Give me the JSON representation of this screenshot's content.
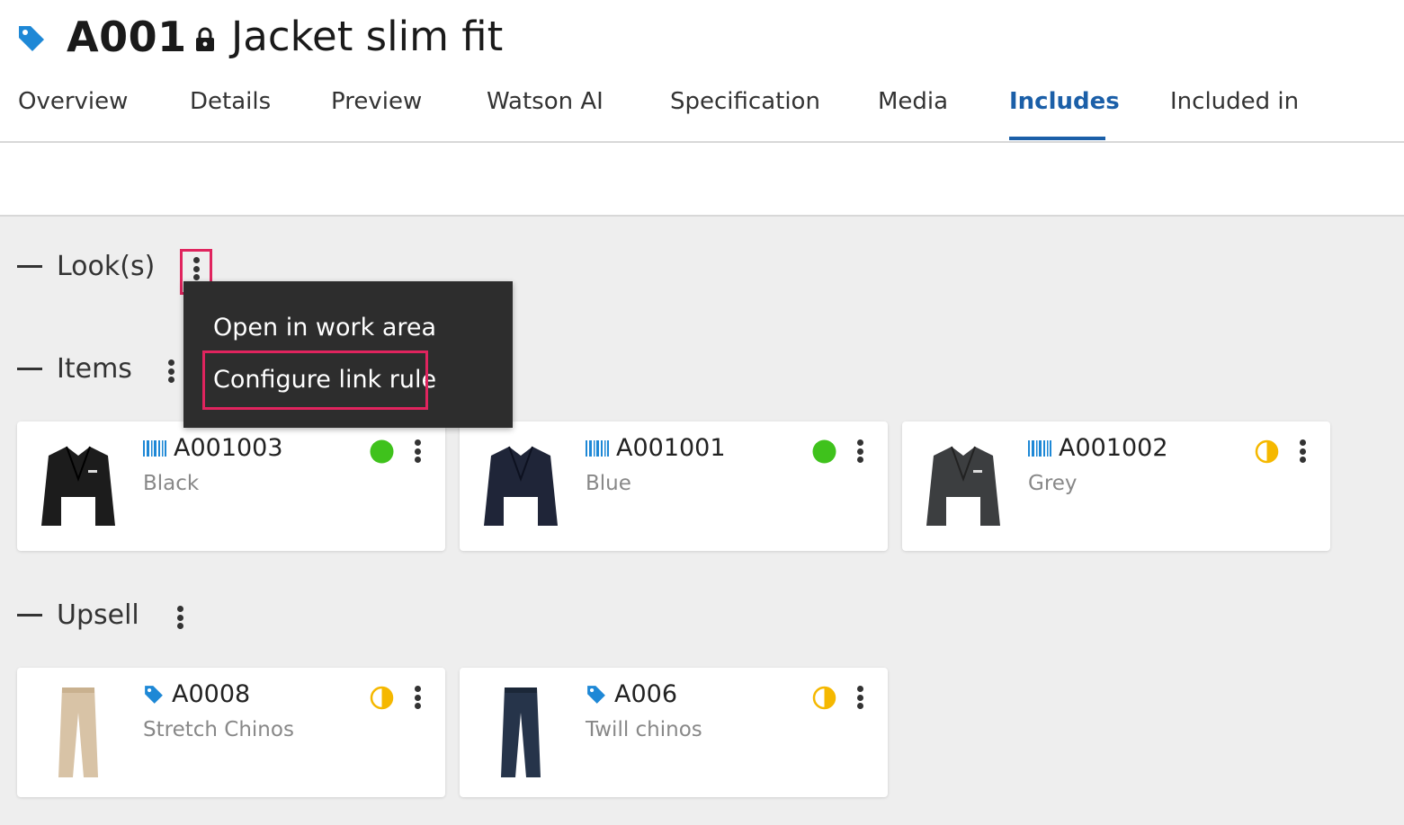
{
  "header": {
    "code": "A001",
    "title": "Jacket slim fit"
  },
  "tabs": [
    {
      "label": "Overview"
    },
    {
      "label": "Details"
    },
    {
      "label": "Preview"
    },
    {
      "label": "Watson AI"
    },
    {
      "label": "Specification"
    },
    {
      "label": "Media"
    },
    {
      "label": "Includes",
      "active": true
    },
    {
      "label": "Included in"
    }
  ],
  "sections": {
    "looks": {
      "title": "Look(s)"
    },
    "items": {
      "title": "Items"
    },
    "upsell": {
      "title": "Upsell"
    }
  },
  "context_menu": {
    "items": [
      {
        "label": "Open in work area"
      },
      {
        "label": "Configure link rule",
        "highlighted": true
      }
    ]
  },
  "items_cards": [
    {
      "code": "A001003",
      "subtitle": "Black",
      "type_icon": "barcode-icon",
      "status": "complete",
      "status_color": "#3fc21c",
      "garment": "jacket",
      "garment_color": "#1c1c1c"
    },
    {
      "code": "A001001",
      "subtitle": "Blue",
      "type_icon": "barcode-icon",
      "status": "complete",
      "status_color": "#3fc21c",
      "garment": "jacket",
      "garment_color": "#1f2538"
    },
    {
      "code": "A001002",
      "subtitle": "Grey",
      "type_icon": "barcode-icon",
      "status": "partial",
      "status_color": "#f5b800",
      "garment": "jacket",
      "garment_color": "#3c3e40"
    }
  ],
  "upsell_cards": [
    {
      "code": "A0008",
      "subtitle": "Stretch Chinos",
      "type_icon": "tag-icon",
      "status": "partial",
      "status_color": "#f5b800",
      "garment": "trousers",
      "garment_color": "#d8c3a6"
    },
    {
      "code": "A006",
      "subtitle": "Twill chinos",
      "type_icon": "tag-icon",
      "status": "partial",
      "status_color": "#f5b800",
      "garment": "trousers",
      "garment_color": "#26344a"
    }
  ],
  "colors": {
    "accent": "#1b5fa8",
    "highlight": "#e0245e",
    "menu_bg": "#2d2d2d",
    "icon_blue": "#1e88d6"
  }
}
